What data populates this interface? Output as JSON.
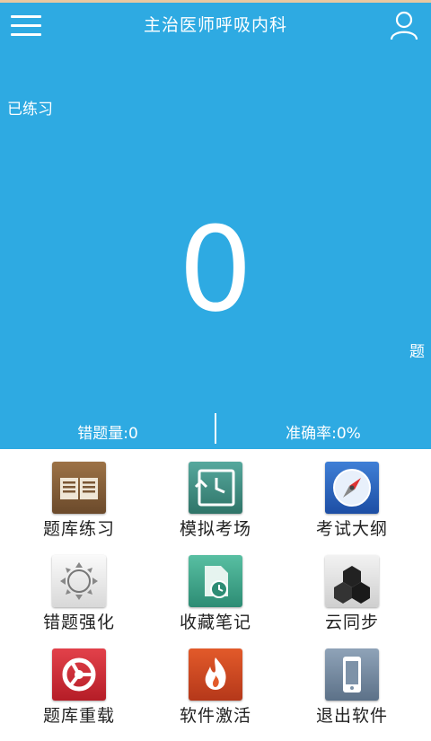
{
  "header": {
    "title": "主治医师呼吸内科",
    "menu_icon": "hamburger-menu-icon",
    "user_icon": "user-profile-icon"
  },
  "progress": {
    "practiced_label": "已练习",
    "count": "0",
    "unit": "题"
  },
  "stats": {
    "wrong": "错题量:0",
    "accuracy": "准确率:0%"
  },
  "colors": {
    "primary": "#2eaae2",
    "top_line": "#e9c8a1"
  },
  "grid": [
    {
      "label": "题库练习",
      "icon": "open-book-icon"
    },
    {
      "label": "模拟考场",
      "icon": "clock-history-icon"
    },
    {
      "label": "考试大纲",
      "icon": "compass-icon"
    },
    {
      "label": "错题强化",
      "icon": "loading-spinner-icon"
    },
    {
      "label": "收藏笔记",
      "icon": "note-clock-icon"
    },
    {
      "label": "云同步",
      "icon": "hexagon-cubes-icon"
    },
    {
      "label": "题库重载",
      "icon": "reload-app-icon"
    },
    {
      "label": "软件激活",
      "icon": "flame-icon"
    },
    {
      "label": "退出软件",
      "icon": "mobile-phone-icon"
    }
  ]
}
